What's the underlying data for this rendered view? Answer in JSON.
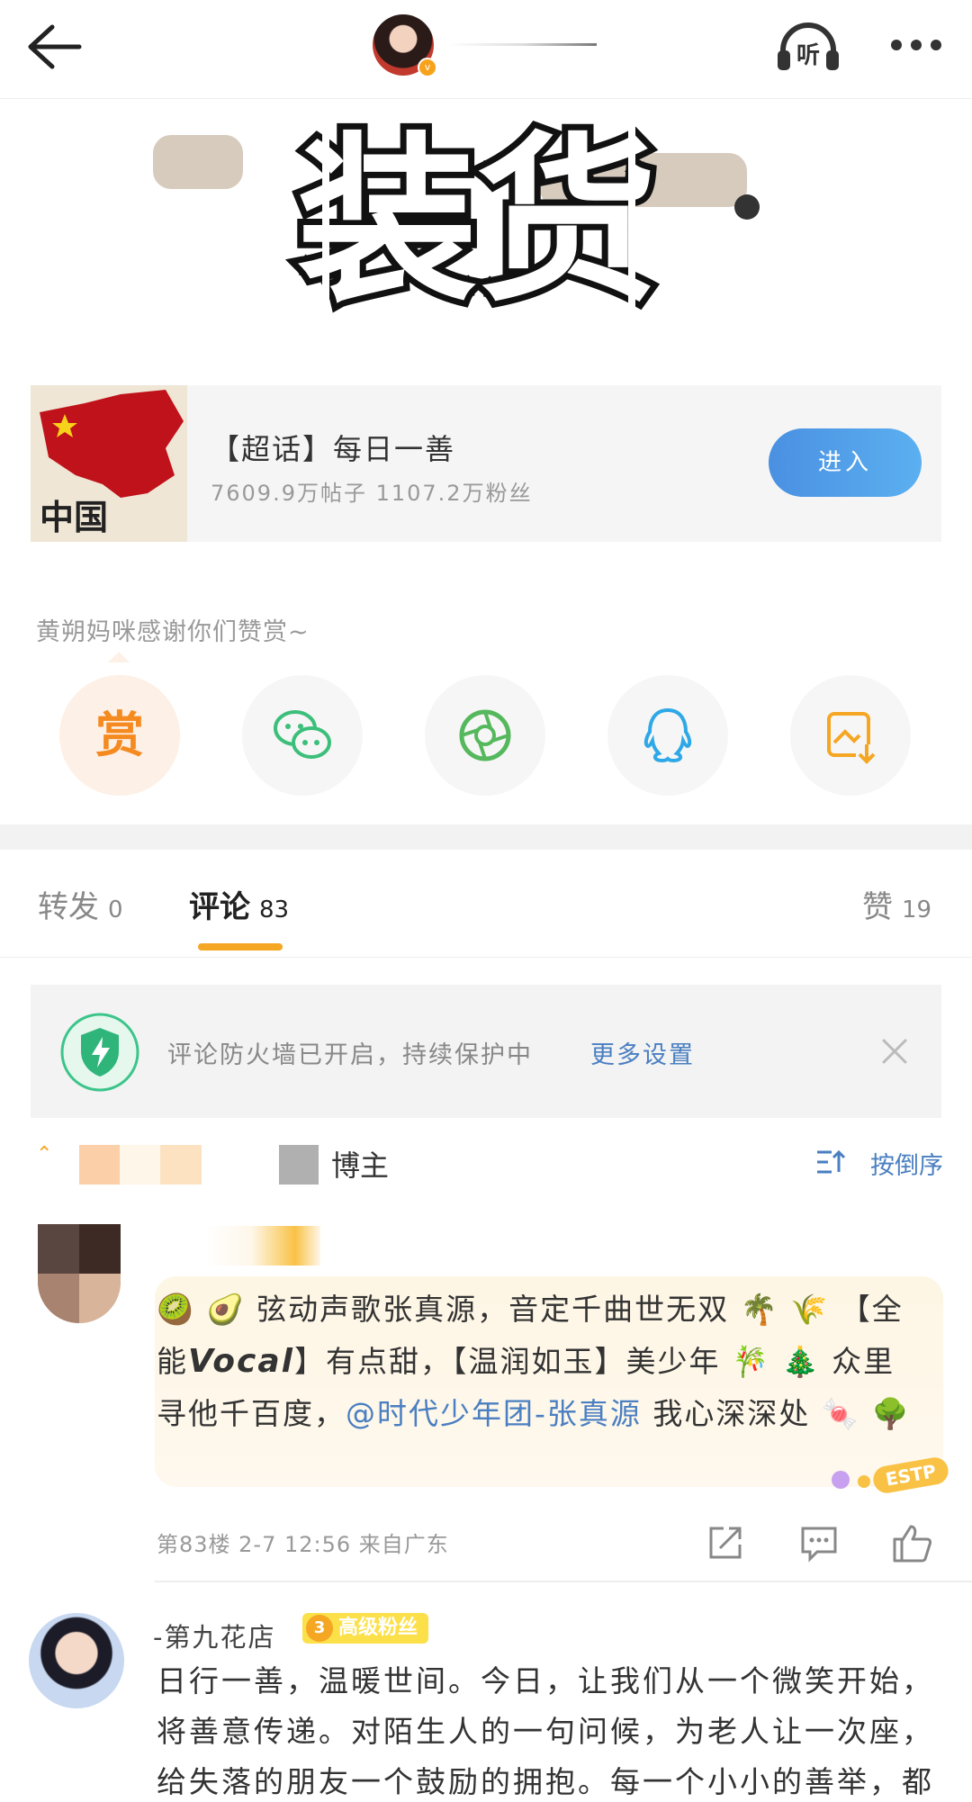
{
  "topbar": {
    "listen_label": "听"
  },
  "sticker": {
    "text": "装货"
  },
  "topic_card": {
    "image_caption": "中国",
    "title": "【超话】每日一善",
    "stats": "7609.9万帖子 1107.2万粉丝",
    "enter_label": "进入"
  },
  "reward": {
    "thanks_text": "黄朔妈咪感谢你们赞赏~",
    "reward_label": "赏",
    "share_icons": [
      "wechat-icon",
      "moments-icon",
      "qq-icon",
      "save-image-icon"
    ]
  },
  "tabs": {
    "repost": {
      "label": "转发",
      "count": "0"
    },
    "comment": {
      "label": "评论",
      "count": "83"
    },
    "like": {
      "label": "赞",
      "count": "19"
    }
  },
  "firewall": {
    "text": "评论防火墙已开启，持续保护中",
    "link": "更多设置"
  },
  "sort_row": {
    "blogger_label": "博主",
    "sort_label": "按倒序"
  },
  "comment1": {
    "text_1": "🥝 🥑 弦动声歌张真源，音定千曲世无双 🌴 🌾 【全能",
    "text_bold": "Vocal",
    "text_2": "】有点甜，【温润如玉】美少年 🎋 🎄 众里寻他千百度，",
    "mention": "@时代少年团-张真源",
    "text_3": " 我心深深处 🍬 🌳",
    "meta": "第83楼 2-7 12:56 来自广东",
    "badge_text": "ESTP"
  },
  "comment2": {
    "name": "-第九花店",
    "fan_level": "3",
    "fan_badge": "高级粉丝",
    "text": "日行一善，温暖世间。今日，让我们从一个微笑开始，将善意传递。对陌生人的一句问候，为老人让一次座，给失落的朋友一个鼓励的拥抱。每一个小小的善举，都是照亮他人的一束光，累积一份份温暖。"
  },
  "colors": {
    "accent": "#f5a623",
    "link": "#4a7fc1",
    "enter_button": "#4a90e2"
  }
}
